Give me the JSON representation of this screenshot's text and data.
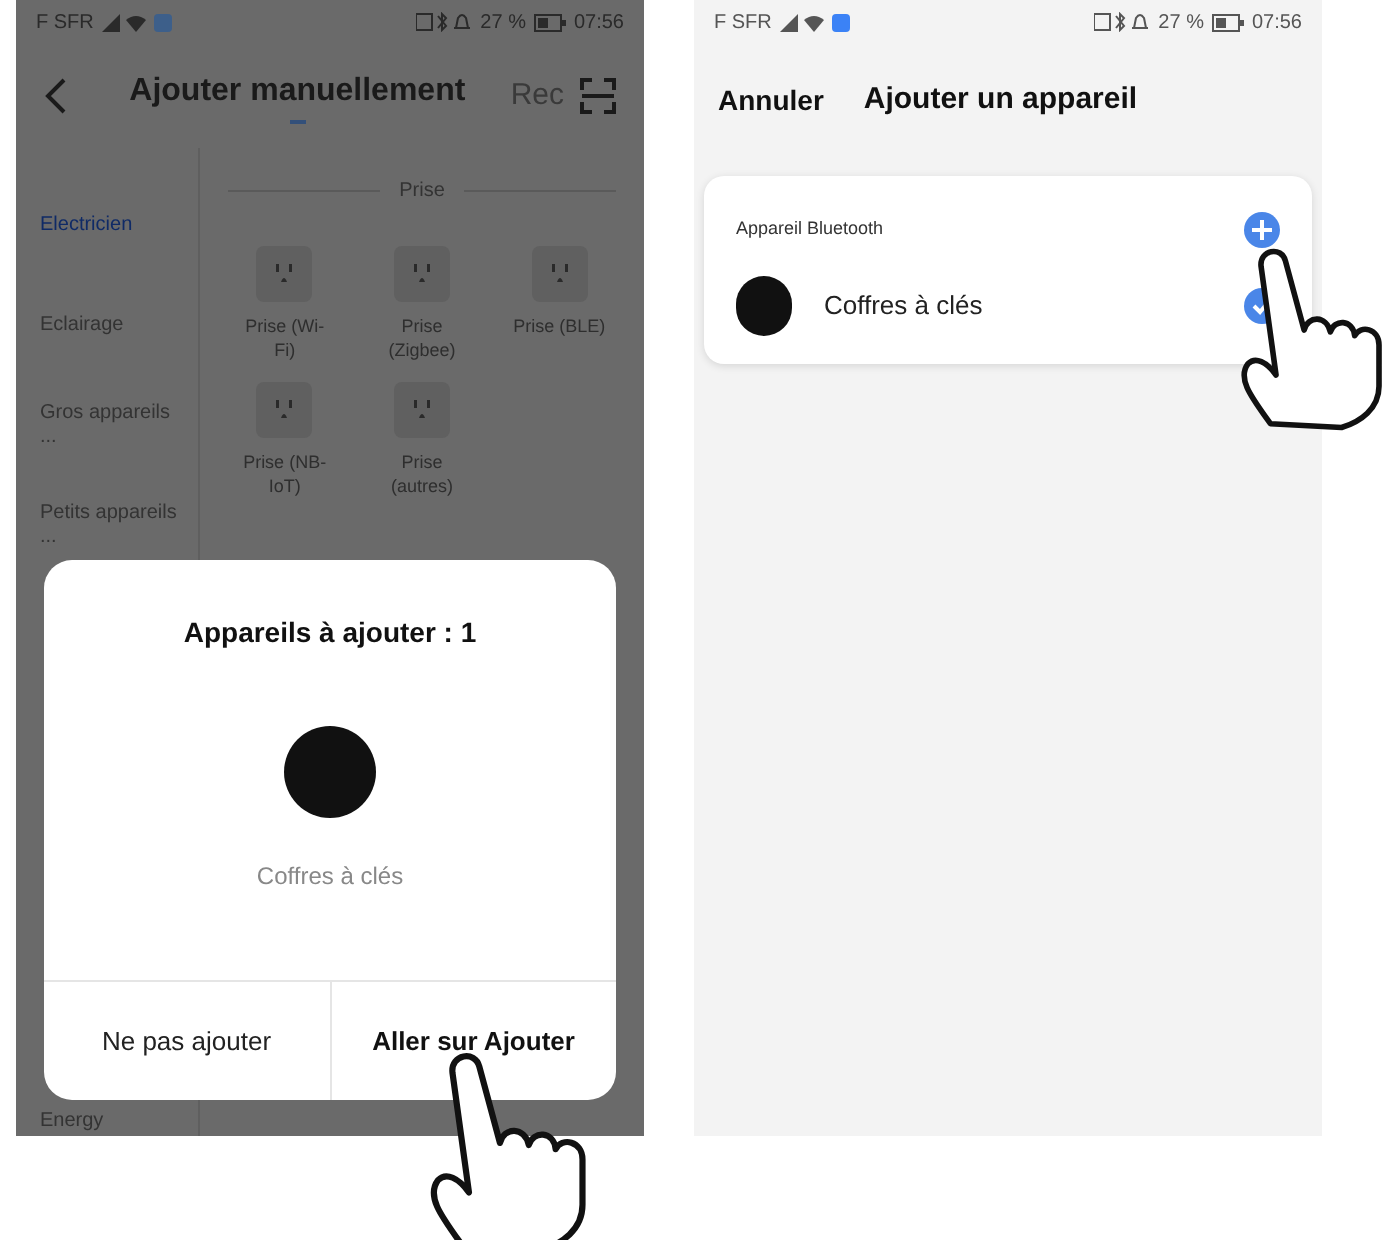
{
  "left_screen": {
    "status_bar": {
      "carrier": "F SFR",
      "battery": "27 %",
      "time": "07:56"
    },
    "header": {
      "title": "Ajouter manuellement",
      "action": "Rec"
    },
    "categories": [
      {
        "label": "Electricien",
        "selected": true
      },
      {
        "label": "Eclairage",
        "selected": false
      },
      {
        "label": "Gros appareils ...",
        "selected": false
      },
      {
        "label": "Petits appareils ...",
        "selected": false
      }
    ],
    "footer_category": "Energy",
    "section_title": "Prise",
    "products": [
      {
        "label": "Prise (Wi-Fi)"
      },
      {
        "label": "Prise (Zigbee)"
      },
      {
        "label": "Prise (BLE)"
      },
      {
        "label": "Prise (NB-IoT)"
      },
      {
        "label": "Prise (autres)"
      }
    ],
    "dialog": {
      "title": "Appareils à ajouter : 1",
      "device_name": "Coffres à clés",
      "buttons": [
        {
          "label": "Ne pas ajouter",
          "primary": false
        },
        {
          "label": "Aller sur Ajouter",
          "primary": true
        }
      ]
    }
  },
  "right_screen": {
    "status_bar": {
      "carrier": "F SFR",
      "battery": "27 %",
      "time": "07:56"
    },
    "header": {
      "cancel": "Annuler",
      "title": "Ajouter un appareil"
    },
    "card": {
      "section_title": "Appareil Bluetooth",
      "devices": [
        {
          "name": "Coffres à clés",
          "checked": true
        }
      ]
    }
  }
}
